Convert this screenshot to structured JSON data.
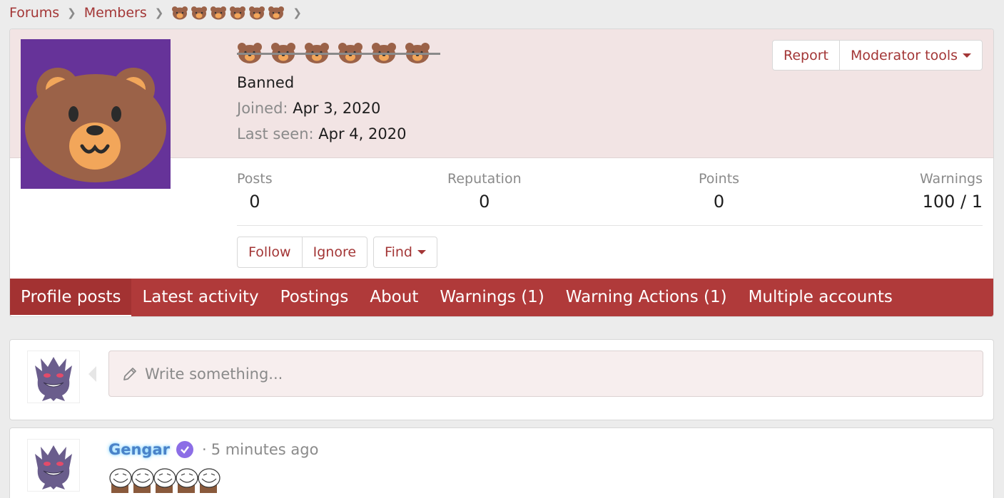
{
  "breadcrumb": {
    "forums": "Forums",
    "members": "Members"
  },
  "profile": {
    "status": "Banned",
    "joined_label": "Joined:",
    "joined_value": "Apr 3, 2020",
    "seen_label": "Last seen:",
    "seen_value": "Apr 4, 2020",
    "name_emoji_count": 6,
    "avatar_bg": "#663399"
  },
  "top_buttons": {
    "report": "Report",
    "moderator_tools": "Moderator tools"
  },
  "stats": {
    "posts_label": "Posts",
    "posts_value": "0",
    "reputation_label": "Reputation",
    "reputation_value": "0",
    "points_label": "Points",
    "points_value": "0",
    "warnings_label": "Warnings",
    "warnings_value": "100 / 1"
  },
  "actions": {
    "follow": "Follow",
    "ignore": "Ignore",
    "find": "Find"
  },
  "tabs": [
    {
      "label": "Profile posts",
      "active": true
    },
    {
      "label": "Latest activity"
    },
    {
      "label": "Postings"
    },
    {
      "label": "About"
    },
    {
      "label": "Warnings (1)"
    },
    {
      "label": "Warning Actions (1)"
    },
    {
      "label": "Multiple accounts"
    }
  ],
  "composer": {
    "placeholder": "Write something..."
  },
  "post": {
    "author": "Gengar",
    "time": "5 minutes ago"
  },
  "colors": {
    "accent": "#a33636",
    "tab_bar": "#b03a3a",
    "header_bg": "#f2e4e4"
  }
}
